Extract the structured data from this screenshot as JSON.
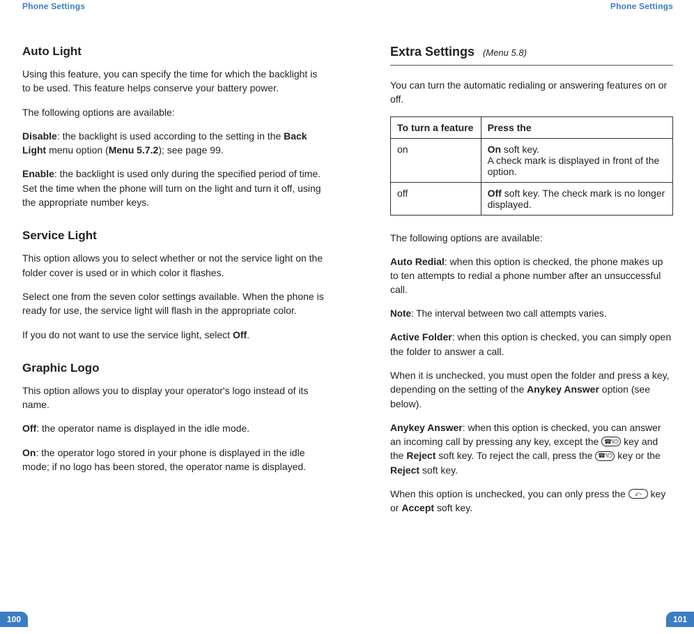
{
  "left": {
    "header": "Phone Settings",
    "page_num": "100",
    "s1": {
      "title": "Auto Light",
      "p1": "Using this feature, you can specify the time for which the backlight is to be used. This feature helps conserve your battery power.",
      "p2": "The following options are available:",
      "p3a": "Disable",
      "p3b": ": the backlight is used according to the setting in the ",
      "p3c": "Back Light",
      "p3d": " menu option (",
      "p3e": "Menu 5.7.2",
      "p3f": "); see page 99.",
      "p4a": "Enable",
      "p4b": ": the backlight is used only during the specified period of time. Set the time when the phone will turn on the light and turn it off, using the appropriate number keys."
    },
    "s2": {
      "title": "Service Light",
      "p1": "This option allows you to select whether or not the service light on the folder cover is used or in which color it flashes.",
      "p2": "Select one from the seven color settings available. When the phone is ready for use, the service light will flash in the appropriate color.",
      "p3a": "If you do not want to use the service light, select ",
      "p3b": "Off",
      "p3c": "."
    },
    "s3": {
      "title": "Graphic Logo",
      "p1": "This option allows you to display your operator's logo instead of its name.",
      "p2a": "Off",
      "p2b": ": the operator name is displayed in the idle mode.",
      "p3a": "On",
      "p3b": ": the operator logo stored in your phone is displayed in the idle mode; if no logo has been stored, the operator name is displayed."
    }
  },
  "right": {
    "header": "Phone Settings",
    "page_num": "101",
    "heading": "Extra Settings",
    "menu": "(Menu 5.8)",
    "intro": "You can turn the automatic redialing or answering features on or off.",
    "table": {
      "h1": "To turn a feature",
      "h2": "Press the",
      "r1c1": "on",
      "r1c2a": "On",
      "r1c2b": " soft key.",
      "r1c2c": "A check mark is displayed in front of the option.",
      "r2c1": "off",
      "r2c2a": "Off",
      "r2c2b": " soft key. The check mark is no longer displayed."
    },
    "p_opts": "The following options are available:",
    "p_ar_a": "Auto Redial",
    "p_ar_b": ": when this option is checked, the phone makes up to ten attempts to redial a phone number after an unsuccessful call.",
    "note_a": "Note",
    "note_b": ": The interval between two call attempts varies.",
    "p_af_a": "Active Folder",
    "p_af_b": ": when this option is checked, you can simply open the folder to answer a call.",
    "p_af2_a": "When it is unchecked, you must open the folder and press a key, depending on the setting of the ",
    "p_af2_b": "Anykey Answer",
    "p_af2_c": " option (see below).",
    "p_aa_a": "Anykey Answer",
    "p_aa_b": ": when this option is checked, you can answer an incoming call by pressing any key, except the ",
    "p_aa_c": " key and the ",
    "p_aa_d": "Reject",
    "p_aa_e": " soft key. To reject the call, press the ",
    "p_aa_f": " key or the ",
    "p_aa_g": "Reject",
    "p_aa_h": " soft key.",
    "p_last_a": "When this option is unchecked, you can only press the ",
    "p_last_b": " key or ",
    "p_last_c": "Accept",
    "p_last_d": " soft key.",
    "icon_end_label": "end-call-icon",
    "icon_send_label": "send-call-icon"
  }
}
